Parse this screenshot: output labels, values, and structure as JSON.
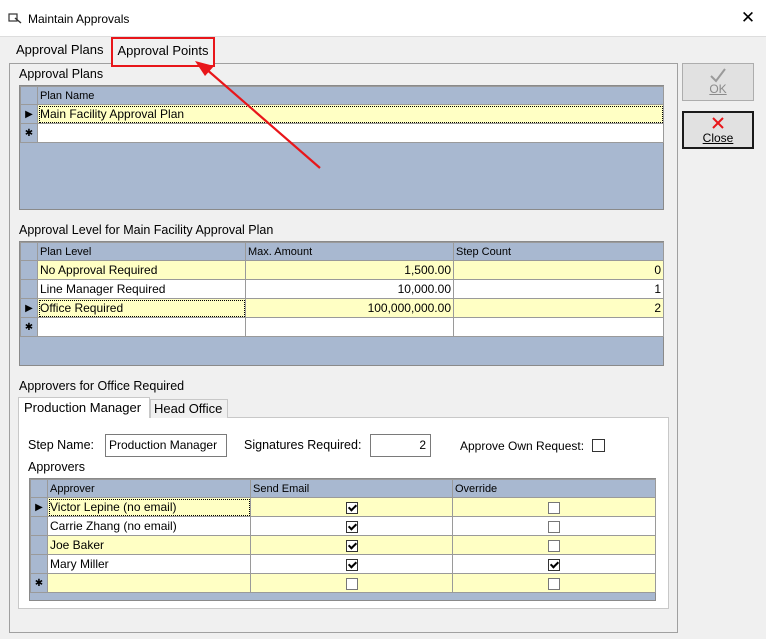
{
  "window": {
    "title": "Maintain Approvals"
  },
  "tabs": [
    {
      "label": "Approval Plans"
    },
    {
      "label": "Approval Points"
    }
  ],
  "buttons": {
    "ok": "OK",
    "close": "Close"
  },
  "plans": {
    "section_label": "Approval Plans",
    "header": "Plan Name",
    "rows": [
      "Main Facility Approval Plan"
    ]
  },
  "levels": {
    "section_label": "Approval Level for Main Facility Approval Plan",
    "headers": [
      "Plan Level",
      "Max. Amount",
      "Step Count"
    ],
    "rows": [
      {
        "level": "No Approval Required",
        "amount": "1,500.00",
        "steps": "0"
      },
      {
        "level": "Line Manager Required",
        "amount": "10,000.00",
        "steps": "1"
      },
      {
        "level": "Office Required",
        "amount": "100,000,000.00",
        "steps": "2"
      }
    ]
  },
  "approvers_section": {
    "section_label": "Approvers for Office Required",
    "subtabs": [
      "Production Manager",
      "Head Office"
    ],
    "step_name_label": "Step Name:",
    "step_name_value": "Production Manager",
    "signatures_label": "Signatures Required:",
    "signatures_value": "2",
    "approve_own_label": "Approve Own Request:",
    "approvers_label": "Approvers",
    "headers": [
      "Approver",
      "Send Email",
      "Override"
    ],
    "rows": [
      {
        "name": "Victor Lepine (no email)",
        "send_email": true,
        "override": false
      },
      {
        "name": "Carrie Zhang (no email)",
        "send_email": true,
        "override": false
      },
      {
        "name": "Joe Baker",
        "send_email": true,
        "override": false
      },
      {
        "name": "Mary Miller",
        "send_email": true,
        "override": true
      }
    ]
  },
  "colors": {
    "highlight_box": "#e8161a",
    "annotation_arrow": "#e8161a",
    "grid_background": "#a8b8d0",
    "row_highlight": "#ffffc4"
  }
}
